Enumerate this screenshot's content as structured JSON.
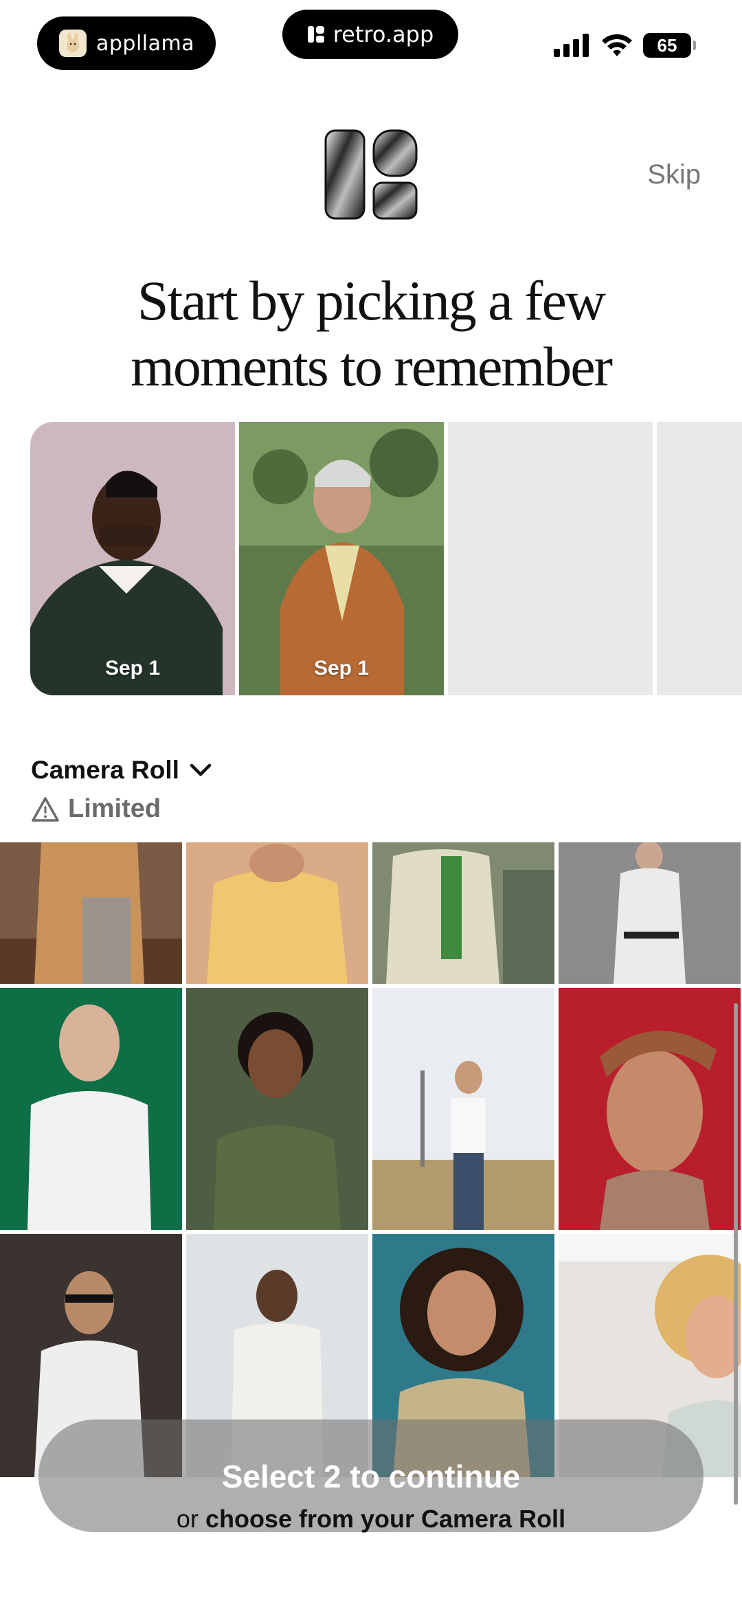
{
  "status_bar": {
    "app_pill_label": "appllama",
    "url_pill_label": "retro.app",
    "battery_level": "65",
    "signal_icon": "signal-icon",
    "wifi_icon": "wifi-icon"
  },
  "header": {
    "skip_label": "Skip",
    "headline_line1": "Start by picking a few",
    "headline_line2": "moments to remember"
  },
  "carousel": {
    "items": [
      {
        "date": "Sep 1"
      },
      {
        "date": "Sep 1"
      },
      {
        "date": ""
      },
      {
        "date": ""
      }
    ]
  },
  "camera_roll": {
    "title": "Camera Roll",
    "access_status": "Limited"
  },
  "footer": {
    "cta_label": "Select 2 to continue",
    "alt_prefix": "or",
    "alt_link": "choose from your Camera Roll"
  },
  "colors": {
    "cta_overlay": "#6e6e6e",
    "muted_text": "#6b6b6b"
  }
}
